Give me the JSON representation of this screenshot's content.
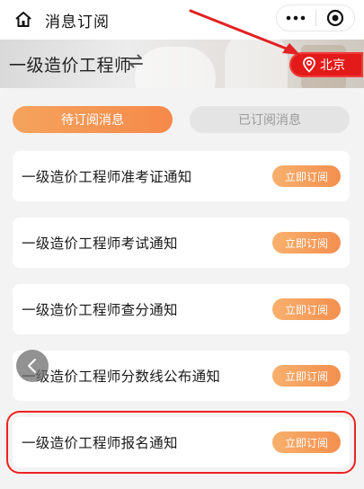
{
  "navbar": {
    "title": "消息订阅",
    "home_icon": "home-icon",
    "more_icon": "more-dots-icon",
    "close_icon": "target-close-icon"
  },
  "banner": {
    "exam_name": "一级造价工程师",
    "switch_icon": "switch-arrows-icon",
    "city": "北京",
    "city_icon": "location-pin-icon"
  },
  "tabs": [
    {
      "label": "待订阅消息",
      "active": true
    },
    {
      "label": "已订阅消息",
      "active": false
    }
  ],
  "notices": [
    {
      "title": "一级造价工程师准考证通知",
      "button": "立即订阅"
    },
    {
      "title": "一级造价工程师考试通知",
      "button": "立即订阅"
    },
    {
      "title": "一级造价工程师查分通知",
      "button": "立即订阅"
    },
    {
      "title": "一级造价工程师分数线公布通知",
      "button": "立即订阅"
    },
    {
      "title": "一级造价工程师报名通知",
      "button": "立即订阅"
    }
  ],
  "colors": {
    "accent": "#f6894a",
    "city_button": "#e31a1a",
    "annotation": "#e22222"
  }
}
